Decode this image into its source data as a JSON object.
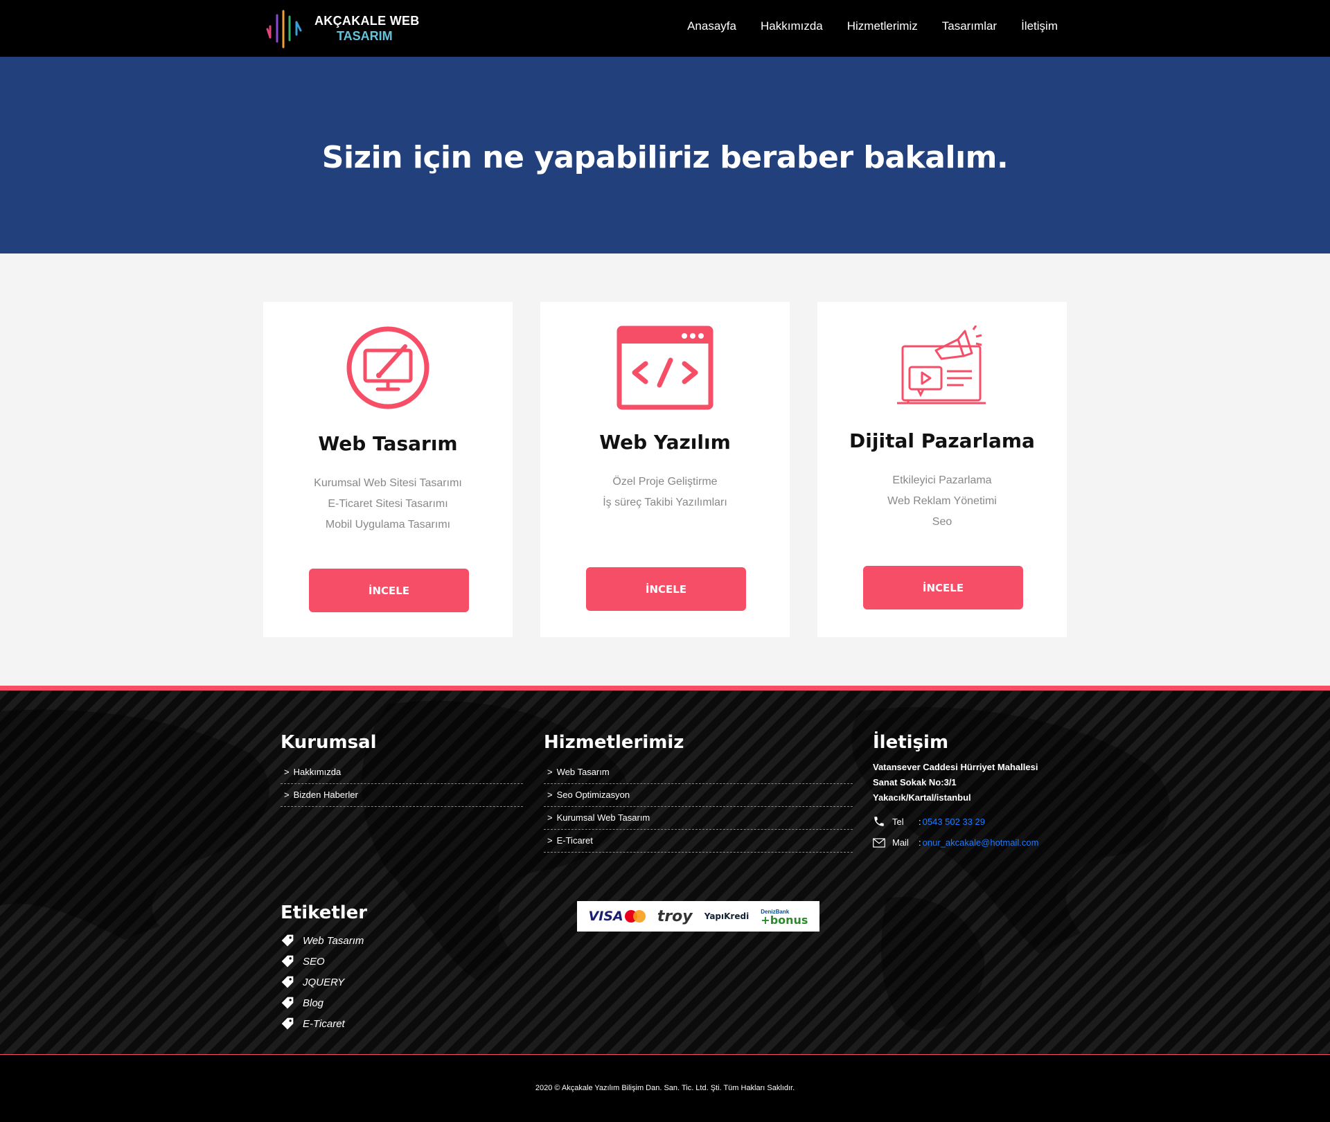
{
  "header": {
    "logo_line1": "AKÇAKALE WEB",
    "logo_line2": "TASARIM",
    "nav": [
      "Anasayfa",
      "Hakkımızda",
      "Hizmetlerimiz",
      "Tasarımlar",
      "İletişim"
    ]
  },
  "hero": {
    "title": "Sizin için ne yapabiliriz beraber bakalım."
  },
  "cards": [
    {
      "icon": "monitor-pen-icon",
      "title": "Web Tasarım",
      "items": [
        "Kurumsal Web Sitesi Tasarımı",
        "E-Ticaret Sitesi Tasarımı",
        "Mobil Uygulama Tasarımı"
      ],
      "button": "İNCELE"
    },
    {
      "icon": "code-window-icon",
      "title": "Web Yazılım",
      "items": [
        "Özel Proje Geliştirme",
        "İş süreç Takibi Yazılımları"
      ],
      "button": "İNCELE"
    },
    {
      "icon": "megaphone-video-icon",
      "title": "Dijital Pazarlama",
      "items": [
        "Etkileyici Pazarlama",
        "Web Reklam Yönetimi",
        "Seo"
      ],
      "button": "İNCELE"
    }
  ],
  "footer": {
    "kurumsal": {
      "title": "Kurumsal",
      "links": [
        "Hakkımızda",
        "Bizden Haberler"
      ]
    },
    "hizmetler": {
      "title": "Hizmetlerimiz",
      "links": [
        "Web Tasarım",
        "Seo Optimizasyon",
        "Kurumsal Web Tasarım",
        "E-Ticaret"
      ]
    },
    "iletisim": {
      "title": "İletişim",
      "address": [
        "Vatansever Caddesi Hürriyet Mahallesi",
        "Sanat Sokak No:3/1",
        "Yakacık/Kartal/istanbul"
      ],
      "tel_label": "Tel",
      "tel": "0543 502 33 29",
      "mail_label": "Mail",
      "mail": "onur_akcakale@hotmail.com"
    },
    "etiketler": {
      "title": "Etiketler",
      "tags": [
        "Web Tasarım",
        "SEO",
        "JQUERY",
        "Blog",
        "E-Ticaret"
      ]
    },
    "payment": {
      "visa": "VISA",
      "mastercard": "MasterCard",
      "troy": "troy",
      "yapikredi": "YapıKredi",
      "denizbank": "DenizBank",
      "bonus": "+bonus"
    },
    "copyright": "2020 © Akçakale Yazılım Bilişim Dan. San. Tic. Ltd. Şti. Tüm Hakları Saklıdır."
  },
  "colors": {
    "accent": "#f74e67",
    "hero_bg": "#22407b",
    "header_bg": "#000000",
    "link": "#1f7bff"
  }
}
